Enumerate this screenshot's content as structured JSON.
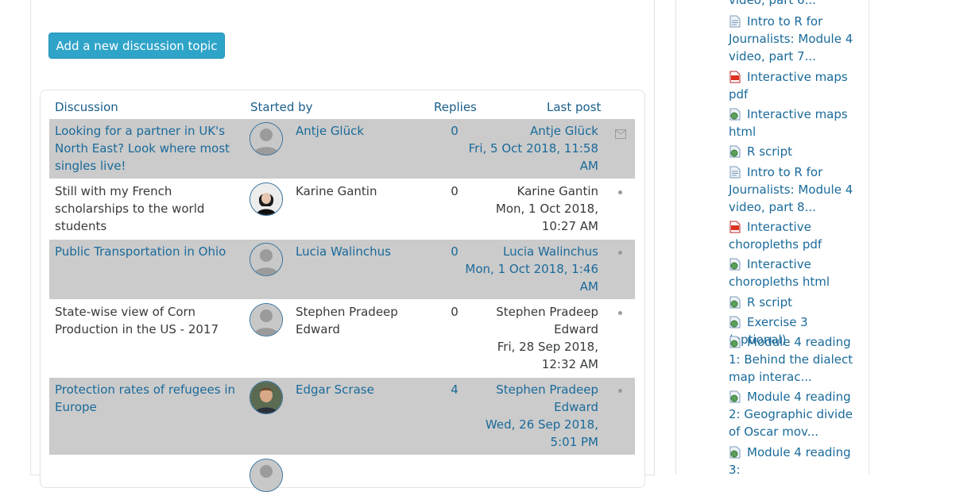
{
  "forum": {
    "add_button_label": "Add a new discussion topic",
    "columns": {
      "discussion": "Discussion",
      "started_by": "Started by",
      "replies": "Replies",
      "last_post": "Last post"
    },
    "rows": [
      {
        "title": "Looking for a partner in UK's North East? Look where most singles live!",
        "author": "Antje Glück",
        "replies": "0",
        "last_author": "Antje Glück",
        "last_date": "Fri, 5 Oct 2018, 11:58 AM",
        "avatar": "default"
      },
      {
        "title": "Still with my French scholarships to the world students",
        "author": "Karine Gantin",
        "replies": "0",
        "last_author": "Karine Gantin",
        "last_date": "Mon, 1 Oct 2018, 10:27 AM",
        "avatar": "photo-woman"
      },
      {
        "title": "Public Transportation in Ohio",
        "author": "Lucia Walinchus",
        "replies": "0",
        "last_author": "Lucia Walinchus",
        "last_date": "Mon, 1 Oct 2018, 1:46 AM",
        "avatar": "default"
      },
      {
        "title": "State-wise view of Corn Production in the US - 2017",
        "author": "Stephen Pradeep Edward",
        "replies": "0",
        "last_author": "Stephen Pradeep Edward",
        "last_date": "Fri, 28 Sep 2018, 12:32 AM",
        "avatar": "default"
      },
      {
        "title": "Protection rates of refugees in Europe",
        "author": "Edgar Scrase",
        "replies": "4",
        "last_author": "Stephen Pradeep Edward",
        "last_date": "Wed, 26 Sep 2018, 5:01 PM",
        "avatar": "photo-man"
      }
    ]
  },
  "sidebar": {
    "items": [
      {
        "icon": "page-icon",
        "label": "video, part 6..."
      },
      {
        "icon": "page-icon",
        "label": "Intro to R for Journalists: Module 4 video, part 7..."
      },
      {
        "icon": "pdf-icon",
        "label": "Interactive maps pdf"
      },
      {
        "icon": "url-icon",
        "label": "Interactive maps html"
      },
      {
        "icon": "url-icon",
        "label": "R script"
      },
      {
        "icon": "page-icon",
        "label": "Intro to R for Journalists: Module 4 video, part 8..."
      },
      {
        "icon": "pdf-icon",
        "label": "Interactive choropleths pdf"
      },
      {
        "icon": "url-icon",
        "label": "Interactive choropleths html"
      },
      {
        "icon": "url-icon",
        "label": "R script"
      },
      {
        "icon": "url-icon",
        "label": "Exercise 3 (optional)"
      },
      {
        "icon": "url-icon",
        "label": "Module 4 reading 1: Behind the dialect map interac..."
      },
      {
        "icon": "url-icon",
        "label": "Module 4 reading 2: Geographic divide of Oscar mov..."
      },
      {
        "icon": "url-icon",
        "label": "Module 4 reading 3:"
      }
    ]
  },
  "colors": {
    "link": "#1a6a9a",
    "button": "#2fa4c9",
    "row_highlight": "#cbcbcb"
  }
}
